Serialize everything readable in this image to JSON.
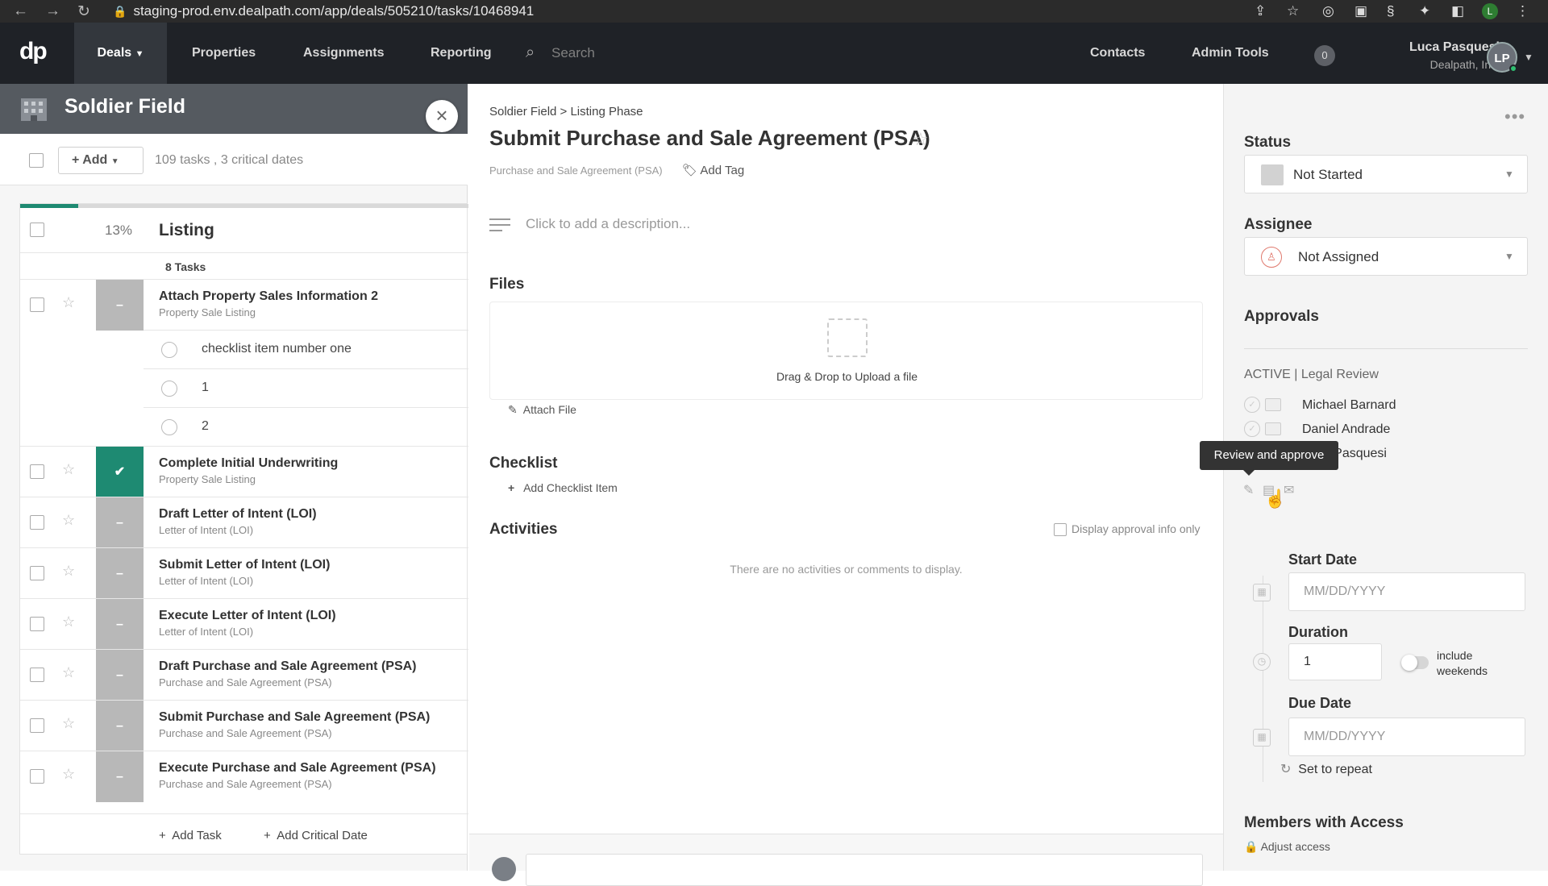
{
  "browser": {
    "url": "staging-prod.env.dealpath.com/app/deals/505210/tasks/10468941"
  },
  "appbar": {
    "logo": "dp",
    "nav": [
      "Deals",
      "Properties",
      "Assignments",
      "Reporting"
    ],
    "search_placeholder": "Search",
    "right_links": [
      "Contacts",
      "Admin Tools"
    ],
    "notification_count": "0",
    "user_name": "Luca Pasquesi",
    "user_org": "Dealpath, Inc.",
    "user_initials": "LP"
  },
  "deal": {
    "title": "Soldier Field",
    "add_label": "Add",
    "summary": "109 tasks , 3 critical dates"
  },
  "listing": {
    "percent": "13%",
    "progress": 0.13,
    "title": "Listing",
    "task_count": "8 Tasks",
    "tasks": [
      {
        "title": "Attach Property Sales Information 2",
        "sub": "Property Sale Listing",
        "status": "–"
      },
      {
        "title": "Complete Initial Underwriting",
        "sub": "Property Sale Listing",
        "status": "✔"
      },
      {
        "title": "Draft Letter of Intent (LOI)",
        "sub": "Letter of Intent (LOI)",
        "status": "–"
      },
      {
        "title": "Submit Letter of Intent (LOI)",
        "sub": "Letter of Intent (LOI)",
        "status": "–"
      },
      {
        "title": "Execute Letter of Intent (LOI)",
        "sub": "Letter of Intent (LOI)",
        "status": "–"
      },
      {
        "title": "Draft Purchase and Sale Agreement (PSA)",
        "sub": "Purchase and Sale Agreement (PSA)",
        "status": "–"
      },
      {
        "title": "Submit Purchase and Sale Agreement (PSA)",
        "sub": "Purchase and Sale Agreement (PSA)",
        "status": "–"
      },
      {
        "title": "Execute Purchase and Sale Agreement (PSA)",
        "sub": "Purchase and Sale Agreement (PSA)",
        "status": "–"
      }
    ],
    "checklist": [
      "checklist item number one",
      "1",
      "2"
    ],
    "add_task": "Add Task",
    "add_critical": "Add Critical Date"
  },
  "detail": {
    "breadcrumb": "Soldier Field  >  Listing Phase",
    "title": "Submit Purchase and Sale Agreement (PSA)",
    "tag": "Purchase and Sale Agreement (PSA)",
    "add_tag": "Add Tag",
    "description_placeholder": "Click to add a description...",
    "files_heading": "Files",
    "upload_text": "Drag & Drop to Upload a file",
    "attach_file": "Attach File",
    "checklist_heading": "Checklist",
    "add_checklist": "Add Checklist Item",
    "activities_heading": "Activities",
    "approval_only": "Display approval info only",
    "no_activities": "There are no activities or comments to display."
  },
  "sidebar": {
    "status_label": "Status",
    "status_value": "Not Started",
    "assignee_label": "Assignee",
    "assignee_value": "Not Assigned",
    "approvals_label": "Approvals",
    "approval_state": "ACTIVE  |  Legal Review",
    "approvers": [
      "Michael Barnard",
      "Daniel Andrade",
      "Luca Pasquesi"
    ],
    "tooltip": "Review and approve",
    "start_label": "Start Date",
    "date_placeholder": "MM/DD/YYYY",
    "duration_label": "Duration",
    "duration_value": "1",
    "weekends_label": "include weekends",
    "due_label": "Due Date",
    "repeat_label": "Set to repeat",
    "members_label": "Members with Access",
    "adjust_label": "Adjust access"
  },
  "colors": {
    "accent": "#1e8a72",
    "appbar": "#1f2227",
    "deal_header": "#555a60"
  }
}
